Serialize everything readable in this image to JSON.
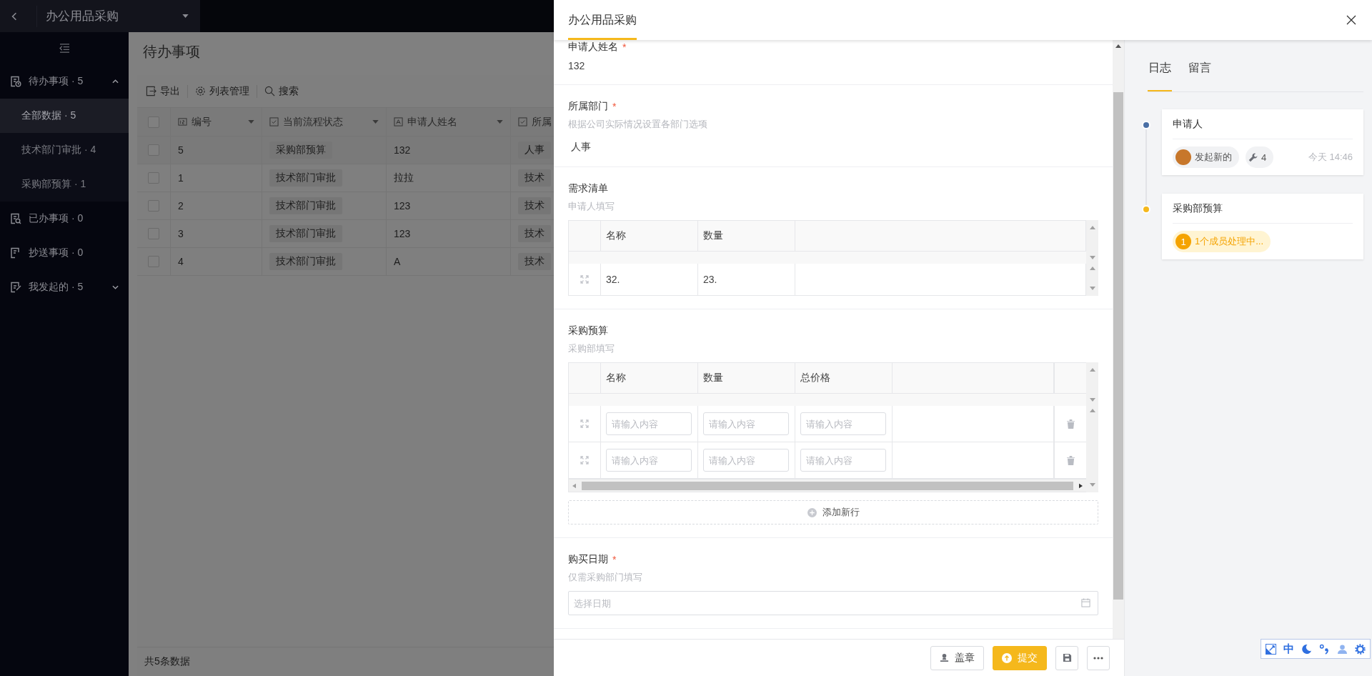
{
  "app_bar": {
    "title": "办公用品采购"
  },
  "sidebar": {
    "items": [
      {
        "label": "待办事项 · 5",
        "kind": "todo",
        "expanded": true,
        "children": [
          {
            "label": "全部数据 · 5",
            "selected": true
          },
          {
            "label": "技术部门审批 · 4",
            "selected": false
          },
          {
            "label": "采购部预算 · 1",
            "selected": false
          }
        ]
      },
      {
        "label": "已办事项 · 0",
        "kind": "done"
      },
      {
        "label": "抄送事项 · 0",
        "kind": "cc"
      },
      {
        "label": "我发起的 · 5",
        "kind": "mine",
        "expanded": false
      }
    ]
  },
  "page": {
    "title": "待办事项",
    "toolbar": [
      {
        "label": "导出",
        "kind": "export"
      },
      {
        "label": "列表管理",
        "kind": "settings"
      },
      {
        "label": "搜索",
        "kind": "search"
      }
    ],
    "table": {
      "select_all_checked": false,
      "columns": [
        {
          "label": "编号",
          "kind": "number"
        },
        {
          "label": "当前流程状态",
          "kind": "check"
        },
        {
          "label": "申请人姓名",
          "kind": "text"
        },
        {
          "label": "所属",
          "kind": "check"
        }
      ],
      "rows": [
        {
          "checked": false,
          "cells": [
            "5",
            "采购部预算",
            "132",
            "人事"
          ]
        },
        {
          "checked": false,
          "cells": [
            "1",
            "技术部门审批",
            "拉拉",
            "技术"
          ]
        },
        {
          "checked": false,
          "cells": [
            "2",
            "技术部门审批",
            "123",
            "技术"
          ]
        },
        {
          "checked": false,
          "cells": [
            "3",
            "技术部门审批",
            "123",
            "技术"
          ]
        },
        {
          "checked": false,
          "cells": [
            "4",
            "技术部门审批",
            "A",
            "技术"
          ]
        }
      ]
    },
    "footer": "共5条数据"
  },
  "drawer": {
    "title": "办公用品采购",
    "fields": [
      {
        "kind": "text",
        "label": "申请人姓名",
        "required_mark": "*",
        "value": "132"
      },
      {
        "kind": "select",
        "label": "所属部门",
        "required_mark": "*",
        "hint": "根据公司实际情况设置各部门选项",
        "value": "人事"
      },
      {
        "kind": "subtable",
        "label": "需求清单",
        "hint": "申请人填写",
        "columns": [
          "名称",
          "数量"
        ],
        "deletable": false,
        "rows": [
          [
            {
              "value": "32."
            },
            {
              "value": "23."
            }
          ]
        ]
      },
      {
        "kind": "subtable",
        "label": "采购预算",
        "hint": "采购部填写",
        "columns": [
          "名称",
          "数量",
          "总价格"
        ],
        "deletable": true,
        "add_label": "添加新行",
        "rows": [
          [
            {
              "placeholder": "请输入内容"
            },
            {
              "placeholder": "请输入内容"
            },
            {
              "placeholder": "请输入内容"
            }
          ],
          [
            {
              "placeholder": "请输入内容"
            },
            {
              "placeholder": "请输入内容"
            },
            {
              "placeholder": "请输入内容"
            }
          ]
        ]
      },
      {
        "kind": "date",
        "label": "购买日期",
        "required_mark": "*",
        "hint": "仅需采购部门填写",
        "placeholder": "选择日期"
      }
    ],
    "buttons": [
      {
        "kind": "stamp",
        "label": "盖章"
      },
      {
        "kind": "submit",
        "label": "提交"
      },
      {
        "kind": "save"
      },
      {
        "kind": "more"
      }
    ]
  },
  "side_panel": {
    "tabs": [
      {
        "label": "日志",
        "selected": true
      },
      {
        "label": "留言",
        "selected": false
      }
    ],
    "timeline": [
      {
        "title": "申请人",
        "color": "#4a6fa5",
        "chips": [
          {
            "kind": "user",
            "label": "发起新的"
          },
          {
            "kind": "tool",
            "label": "4"
          }
        ],
        "time": "今天 14:46"
      },
      {
        "title": "采购部预算",
        "color": "#f5b81c",
        "chips": [
          {
            "kind": "pending",
            "count": "1",
            "label": "1个成员处理中..."
          }
        ]
      }
    ]
  },
  "ime_toolbar": {
    "mode": "中"
  }
}
